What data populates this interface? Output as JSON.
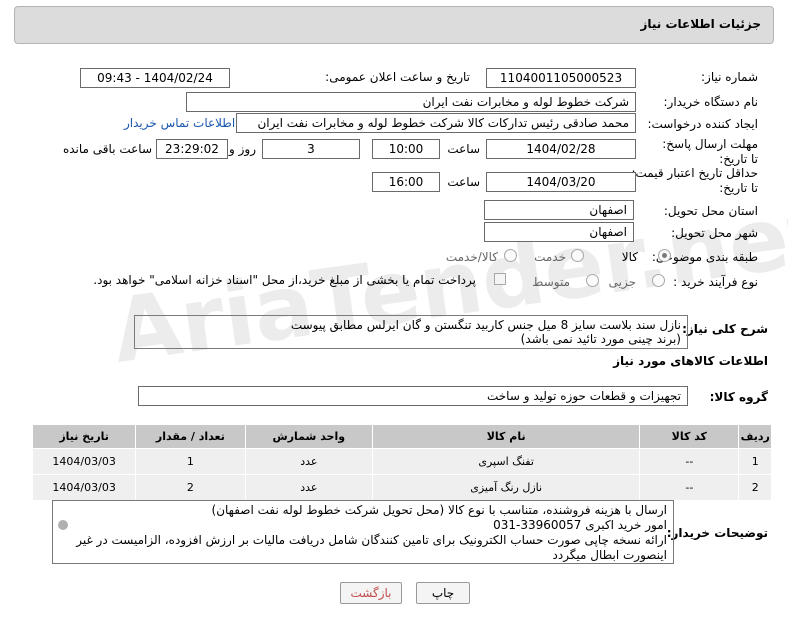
{
  "header": {
    "title": "جزئیات اطلاعات نیاز"
  },
  "fields": {
    "need_number_label": "شماره نیاز:",
    "need_number": "1104001105000523",
    "announce_label": "تاریخ و ساعت اعلان عمومی:",
    "announce_value": "1404/02/24 - 09:43",
    "buyer_org_label": "نام دستگاه خریدار:",
    "buyer_org": "شرکت خطوط لوله و مخابرات نفت ایران",
    "requester_label": "ایجاد کننده درخواست:",
    "requester": "محمد صادقی رئیس تدارکات کالا  شرکت خطوط لوله و مخابرات نفت ایران",
    "contact_link": "اطلاعات تماس خریدار",
    "deadline_label": "مهلت ارسال پاسخ: تا تاریخ:",
    "deadline_date": "1404/02/28",
    "time_label": "ساعت",
    "deadline_time": "10:00",
    "days_value": "3",
    "days_label": "روز و",
    "remaining_time": "23:29:02",
    "remaining_label": "ساعت باقی مانده",
    "min_price_label": "حداقل تاریخ اعتبار قیمت: تا تاریخ:",
    "min_price_date": "1404/03/20",
    "min_price_time": "16:00",
    "province_label": "استان محل تحویل:",
    "province": "اصفهان",
    "city_label": "شهر محل تحویل:",
    "city": "اصفهان",
    "category_label": "طبقه بندی موضوعی:",
    "category_options": [
      "کالا",
      "خدمت",
      "کالا/خدمت"
    ],
    "process_label": "نوع فرآیند خرید :",
    "process_options": [
      "جزیی",
      "متوسط"
    ],
    "payment_note": "پرداخت تمام یا بخشی از مبلغ خرید،از محل \"اسناد خزانه اسلامی\" خواهد بود.",
    "description_label": "شرح کلی نیاز:",
    "description_line1": "نازل سند بلاست سایز 8 میل جنس کاربید تنگستن و گان ایرلس مطابق پیوست",
    "description_line2": "(برند چینی مورد تائید نمی باشد)",
    "goods_info_title": "اطلاعات کالاهای مورد نیاز",
    "goods_group_label": "گروه کالا:",
    "goods_group": "تجهیزات و قطعات حوزه تولید و ساخت"
  },
  "table": {
    "headers": [
      "ردیف",
      "کد کالا",
      "نام کالا",
      "واحد شمارش",
      "تعداد / مقدار",
      "تاریخ نیاز"
    ],
    "rows": [
      [
        "1",
        "--",
        "تفنگ اسپری",
        "عدد",
        "1",
        "1404/03/03"
      ],
      [
        "2",
        "--",
        "نازل رنگ آمیزی",
        "عدد",
        "2",
        "1404/03/03"
      ]
    ]
  },
  "notes": {
    "label": "توضیحات خریدار:",
    "line1": "ارسال  با هزینه فروشنده، متناسب با نوع کالا (محل تحویل شرکت خطوط لوله نفت اصفهان)",
    "line2": "امور خرید اکبری 33960057-031",
    "line3": "ارائه نسخه چاپی صورت حساب الکترونیک برای تامین کنندگان شامل دریافت مالیات بر ارزش افزوده، الزامیست در غیر",
    "line4": "اینصورت ابطال میگردد"
  },
  "buttons": {
    "print": "چاپ",
    "back": "بازگشت"
  },
  "watermark": "AriaTender.net"
}
